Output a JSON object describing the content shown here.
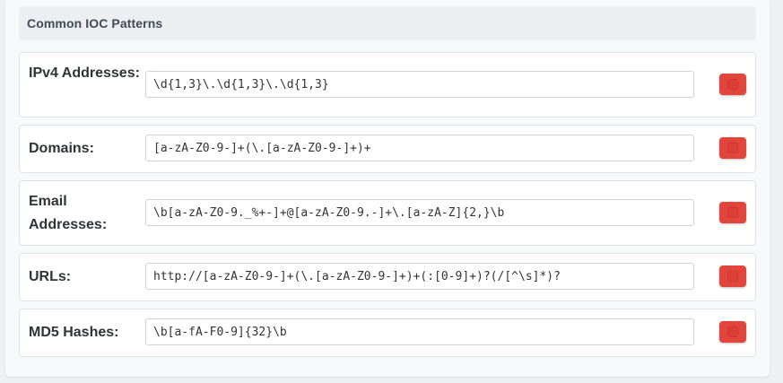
{
  "section": {
    "title": "Common IOC Patterns"
  },
  "patterns": [
    {
      "label": "IPv4 Addresses:",
      "value": "\\d{1,3}\\.\\d{1,3}\\.\\d{1,3}"
    },
    {
      "label": "Domains:",
      "value": "[a-zA-Z0-9-]+(\\.[a-zA-Z0-9-]+)+"
    },
    {
      "label": "Email Addresses:",
      "value": "\\b[a-zA-Z0-9._%+-]+@[a-zA-Z0-9.-]+\\.[a-zA-Z]{2,}\\b"
    },
    {
      "label": "URLs:",
      "value": "http://[a-zA-Z0-9-]+(\\.[a-zA-Z0-9-]+)+(:[0-9]+)?(/[^\\s]*)?"
    },
    {
      "label": "MD5 Hashes:",
      "value": "\\b[a-fA-F0-9]{32}\\b"
    }
  ],
  "icons": {
    "action_button_icon": "delete-icon"
  },
  "colors": {
    "action_button": "#e2453c",
    "label_text": "#2f3338",
    "header_bg": "#eceef1"
  }
}
